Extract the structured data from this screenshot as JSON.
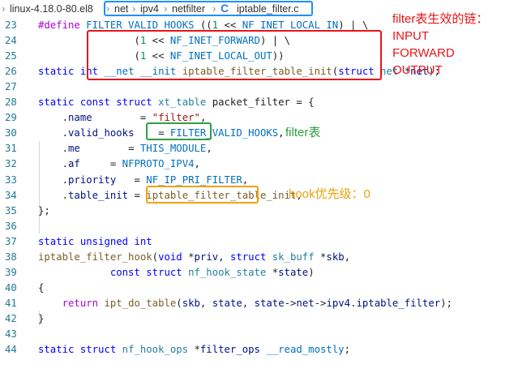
{
  "breadcrumb": {
    "root": "linux-4.18.0-80.el8",
    "net": "net",
    "ipv4": "ipv4",
    "netfilter": "netfilter",
    "file": "iptable_filter.c",
    "file_icon": "C"
  },
  "annotations": {
    "red_title": "filter表生效的链：",
    "red_chains": [
      "INPUT",
      "FORWARD",
      "OUTPUT"
    ],
    "green": "filter表",
    "orange": "hook优先级：0"
  },
  "colors": {
    "red_box": "#e8141a",
    "green_box": "#2ea043",
    "orange_box": "#f0a30a",
    "blue_box": "#1e90ff"
  },
  "lines": [
    {
      "n": "23",
      "t": [
        [
          "#define ",
          "k-pp"
        ],
        [
          "FILTER_VALID_HOOKS",
          "k-macro"
        ],
        [
          " ((",
          ""
        ],
        [
          "1",
          "k-num"
        ],
        [
          " << ",
          ""
        ],
        [
          "NF_INET_LOCAL_IN",
          "k-macro"
        ],
        [
          ") | \\",
          ""
        ]
      ]
    },
    {
      "n": "24",
      "t": [
        [
          "                (",
          ""
        ],
        [
          "1",
          "k-num"
        ],
        [
          " << ",
          ""
        ],
        [
          "NF_INET_FORWARD",
          "k-macro"
        ],
        [
          ") | \\",
          ""
        ]
      ]
    },
    {
      "n": "25",
      "t": [
        [
          "                (",
          ""
        ],
        [
          "1",
          "k-num"
        ],
        [
          " << ",
          ""
        ],
        [
          "NF_INET_LOCAL_OUT",
          "k-macro"
        ],
        [
          "))",
          ""
        ]
      ]
    },
    {
      "n": "26",
      "t": [
        [
          "static ",
          "k-blue"
        ],
        [
          "int ",
          "k-blue"
        ],
        [
          "__net ",
          "k-macro"
        ],
        [
          "__init ",
          "k-macro"
        ],
        [
          "iptable_filter_table_init",
          "k-fn"
        ],
        [
          "(",
          ""
        ],
        [
          "struct ",
          "k-blue"
        ],
        [
          "net ",
          "k-type"
        ],
        [
          "*",
          ""
        ],
        [
          "net",
          "k-var"
        ],
        [
          ");",
          ""
        ]
      ]
    },
    {
      "n": "27",
      "t": []
    },
    {
      "n": "28",
      "t": [
        [
          "static ",
          "k-blue"
        ],
        [
          "const ",
          "k-blue"
        ],
        [
          "struct ",
          "k-blue"
        ],
        [
          "xt_table ",
          "k-type"
        ],
        [
          "packet_filter = {",
          ""
        ]
      ]
    },
    {
      "n": "29",
      "t": [
        [
          "    .",
          ""
        ],
        [
          "name",
          "k-var"
        ],
        [
          "        = ",
          ""
        ],
        [
          "\"filter\"",
          "k-str"
        ],
        [
          ",",
          ""
        ]
      ]
    },
    {
      "n": "30",
      "t": [
        [
          "    .",
          ""
        ],
        [
          "valid_hooks",
          "k-var"
        ],
        [
          "    = ",
          ""
        ],
        [
          "FILTER_VALID_HOOKS",
          "k-macro"
        ],
        [
          ",",
          ""
        ]
      ]
    },
    {
      "n": "31",
      "t": [
        [
          "    .",
          ""
        ],
        [
          "me",
          "k-var"
        ],
        [
          "        = ",
          ""
        ],
        [
          "THIS_MODULE",
          "k-macro"
        ],
        [
          ",",
          ""
        ]
      ]
    },
    {
      "n": "32",
      "t": [
        [
          "    .",
          ""
        ],
        [
          "af",
          "k-var"
        ],
        [
          "     = ",
          ""
        ],
        [
          "NFPROTO_IPV4",
          "k-macro"
        ],
        [
          ",",
          ""
        ]
      ]
    },
    {
      "n": "33",
      "t": [
        [
          "    .",
          ""
        ],
        [
          "priority",
          "k-var"
        ],
        [
          "   = ",
          ""
        ],
        [
          "NF_IP_PRI_FILTER",
          "k-macro"
        ],
        [
          ",",
          ""
        ]
      ]
    },
    {
      "n": "34",
      "t": [
        [
          "    .",
          ""
        ],
        [
          "table_init",
          "k-var"
        ],
        [
          " = ",
          ""
        ],
        [
          "iptable_filter_table_init",
          "k-fn"
        ],
        [
          ",",
          ""
        ]
      ]
    },
    {
      "n": "35",
      "t": [
        [
          "};",
          ""
        ]
      ]
    },
    {
      "n": "36",
      "t": []
    },
    {
      "n": "37",
      "t": [
        [
          "static ",
          "k-blue"
        ],
        [
          "unsigned ",
          "k-blue"
        ],
        [
          "int",
          "k-blue"
        ]
      ]
    },
    {
      "n": "38",
      "t": [
        [
          "iptable_filter_hook",
          "k-fn"
        ],
        [
          "(",
          ""
        ],
        [
          "void ",
          "k-blue"
        ],
        [
          "*",
          ""
        ],
        [
          "priv",
          "k-var"
        ],
        [
          ", ",
          ""
        ],
        [
          "struct ",
          "k-blue"
        ],
        [
          "sk_buff ",
          "k-type"
        ],
        [
          "*",
          ""
        ],
        [
          "skb",
          "k-var"
        ],
        [
          ",",
          ""
        ]
      ]
    },
    {
      "n": "39",
      "t": [
        [
          "            ",
          ""
        ],
        [
          "const ",
          "k-blue"
        ],
        [
          "struct ",
          "k-blue"
        ],
        [
          "nf_hook_state ",
          "k-type"
        ],
        [
          "*",
          ""
        ],
        [
          "state",
          "k-var"
        ],
        [
          ")",
          ""
        ]
      ]
    },
    {
      "n": "40",
      "t": [
        [
          "{",
          ""
        ]
      ]
    },
    {
      "n": "41",
      "t": [
        [
          "    ",
          ""
        ],
        [
          "return ",
          "k-pp"
        ],
        [
          "ipt_do_table",
          "k-fn"
        ],
        [
          "(",
          ""
        ],
        [
          "skb",
          "k-var"
        ],
        [
          ", ",
          ""
        ],
        [
          "state",
          "k-var"
        ],
        [
          ", ",
          ""
        ],
        [
          "state",
          "k-var"
        ],
        [
          "->",
          ""
        ],
        [
          "net",
          "k-var"
        ],
        [
          "->",
          ""
        ],
        [
          "ipv4",
          "k-var"
        ],
        [
          ".",
          ""
        ],
        [
          "iptable_filter",
          "k-var"
        ],
        [
          ");",
          ""
        ]
      ]
    },
    {
      "n": "42",
      "t": [
        [
          "}",
          ""
        ]
      ]
    },
    {
      "n": "43",
      "t": []
    },
    {
      "n": "44",
      "t": [
        [
          "static ",
          "k-blue"
        ],
        [
          "struct ",
          "k-blue"
        ],
        [
          "nf_hook_ops ",
          "k-type"
        ],
        [
          "*",
          ""
        ],
        [
          "filter_ops ",
          "k-var"
        ],
        [
          "__read_mostly",
          "k-macro"
        ],
        [
          ";",
          ""
        ]
      ]
    }
  ]
}
